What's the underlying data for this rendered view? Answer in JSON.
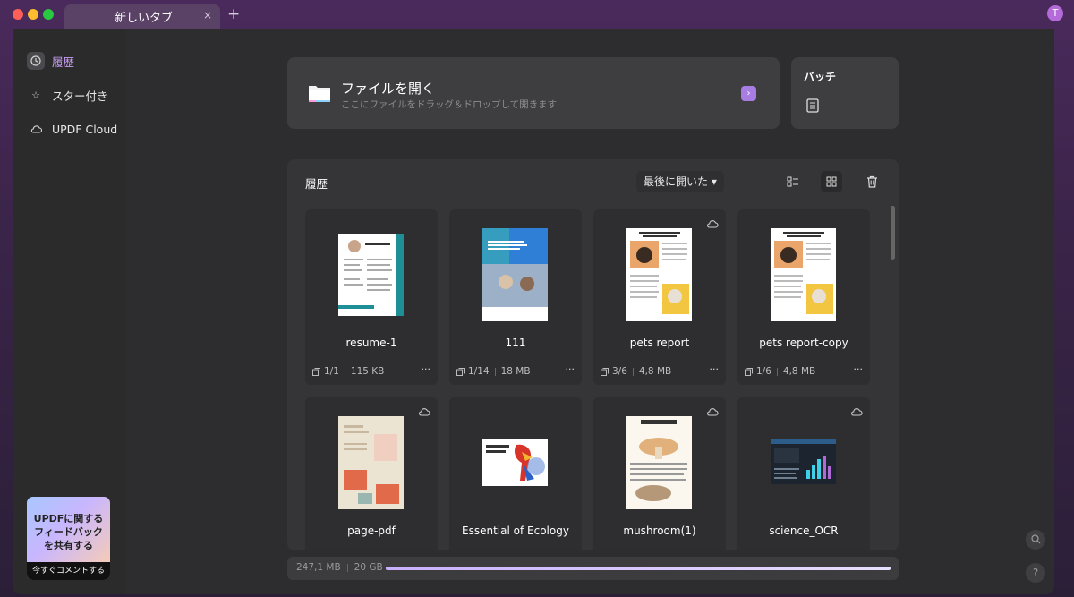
{
  "tab": {
    "title": "新しいタブ",
    "close_label": "×",
    "new_tab_label": "+"
  },
  "user": {
    "avatar_letter": "T"
  },
  "sidebar": {
    "items": [
      {
        "label": "履歴",
        "icon": "clock-icon",
        "active": true
      },
      {
        "label": "スター付き",
        "icon": "star-icon",
        "active": false
      },
      {
        "label": "UPDF Cloud",
        "icon": "cloud-icon",
        "active": false
      }
    ],
    "feedback": {
      "text": "UPDFに関する\nフィードバック\nを共有する",
      "button": "今すぐコメントする"
    }
  },
  "open_file": {
    "title": "ファイルを開く",
    "subtitle": "ここにファイルをドラッグ＆ドロップして開きます",
    "arrow": "›"
  },
  "batch": {
    "title": "バッチ"
  },
  "history": {
    "title": "履歴",
    "sort_label": "最後に開いた ▾",
    "files": [
      {
        "name": "resume-1",
        "pages": "1/1",
        "size": "115 KB",
        "cloud": false,
        "thumb": "resume"
      },
      {
        "name": "111",
        "pages": "1/14",
        "size": "18 MB",
        "cloud": false,
        "thumb": "strategy"
      },
      {
        "name": "pets report",
        "pages": "3/6",
        "size": "4,8 MB",
        "cloud": true,
        "thumb": "pets"
      },
      {
        "name": "pets report-copy",
        "pages": "1/6",
        "size": "4,8 MB",
        "cloud": false,
        "thumb": "pets"
      },
      {
        "name": "page-pdf",
        "pages": "",
        "size": "",
        "cloud": true,
        "thumb": "pagepdf"
      },
      {
        "name": "Essential of Ecology",
        "pages": "",
        "size": "",
        "cloud": false,
        "thumb": "ecology"
      },
      {
        "name": "mushroom(1)",
        "pages": "",
        "size": "",
        "cloud": true,
        "thumb": "mushroom"
      },
      {
        "name": "science_OCR",
        "pages": "",
        "size": "",
        "cloud": true,
        "thumb": "science"
      }
    ],
    "more_label": "···"
  },
  "storage": {
    "used": "247,1 MB",
    "total": "20 GB",
    "fill_fraction": 1.0
  },
  "colors": {
    "accent": "#a77de3",
    "window_bg": "#2d2d2f",
    "panel_bg": "#353537"
  }
}
